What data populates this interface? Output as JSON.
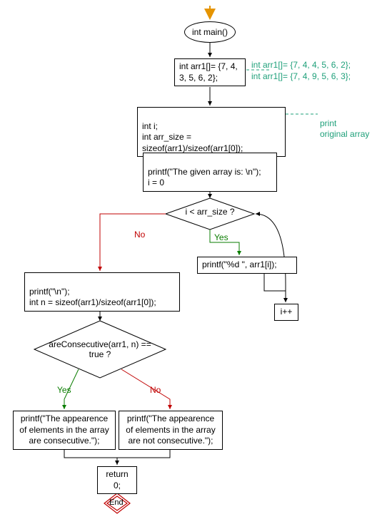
{
  "start": {
    "label": "int main()"
  },
  "box_arr1": {
    "text": "int arr1[]= {7, 4, 3, 5, 6, 2};"
  },
  "comment_arr_alts": {
    "line1": "int arr1[]= {7, 4, 4, 5, 6, 2};",
    "line2": "int arr1[]= {7, 4, 9, 5, 6, 3};"
  },
  "box_init": {
    "text": "int i;\nint arr_size = sizeof(arr1)/sizeof(arr1[0]);"
  },
  "comment_print": {
    "text": "print\noriginal array"
  },
  "box_printf_header": {
    "text": "printf(\"The given array is:  \\n\");\ni = 0"
  },
  "diamond_loop": {
    "text": "i < arr_size ?"
  },
  "loop_labels": {
    "yes": "Yes",
    "no": "No"
  },
  "box_print_elem": {
    "text": "printf(\"%d  \", arr1[i]);"
  },
  "box_incr": {
    "text": "i++"
  },
  "box_after_loop": {
    "text": "printf(\"\\n\");\nint n = sizeof(arr1)/sizeof(arr1[0]);"
  },
  "diamond_check": {
    "text": "areConsecutive(arr1, n) == true ?"
  },
  "check_labels": {
    "yes": "Yes",
    "no": "No"
  },
  "box_consec_yes": {
    "text": "printf(\"The appearence of elements in the array are consecutive.\");"
  },
  "box_consec_no": {
    "text": "printf(\"The appearence of elements in the array are not consecutive.\");"
  },
  "box_return": {
    "text": "return 0;"
  },
  "end": {
    "label": "End"
  }
}
